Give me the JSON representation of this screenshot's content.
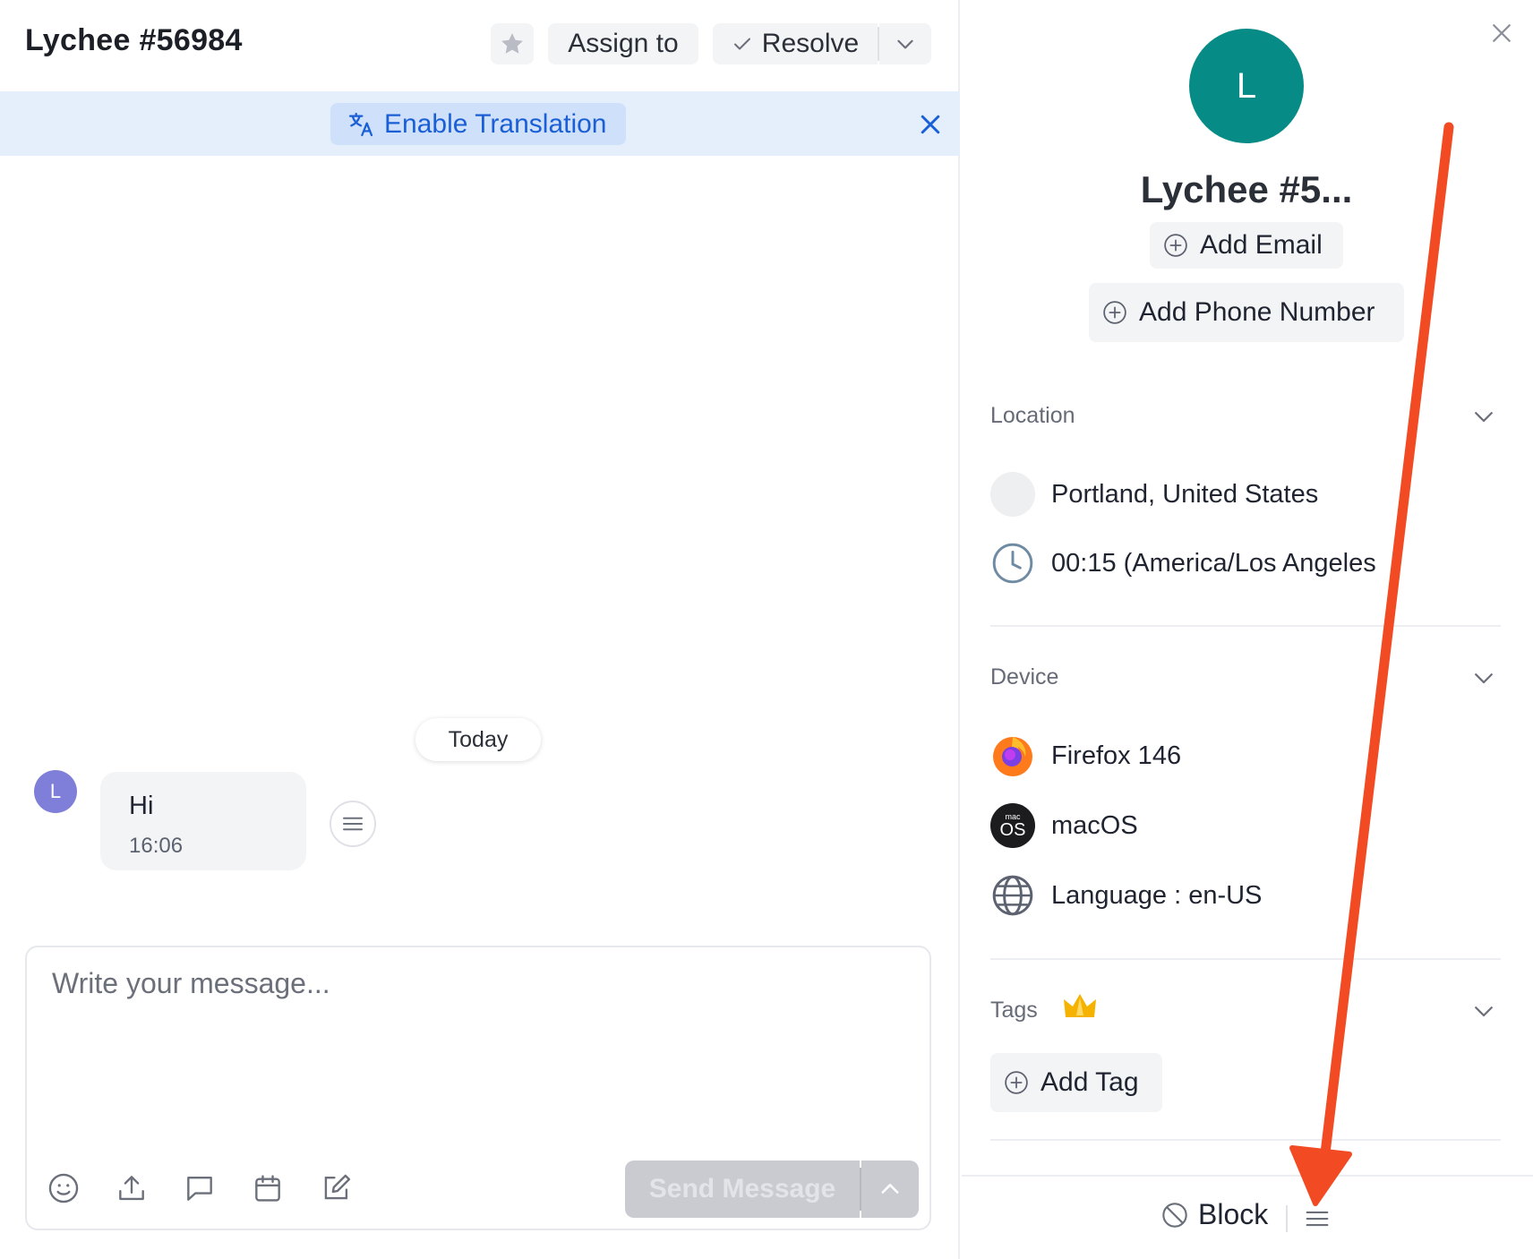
{
  "conversation": {
    "title": "Lychee #56984",
    "assign_label": "Assign to",
    "resolve_label": "Resolve"
  },
  "translation": {
    "button_label": "Enable Translation"
  },
  "messages": {
    "date_separator": "Today",
    "avatar_initial": "L",
    "items": [
      {
        "text": "Hi",
        "time": "16:06"
      }
    ]
  },
  "composer": {
    "placeholder": "Write your message...",
    "send_label": "Send Message",
    "tools": [
      "emoji-icon",
      "upload-icon",
      "chat-bubble-icon",
      "calendar-icon",
      "edit-icon"
    ]
  },
  "contact": {
    "avatar_initial": "L",
    "name": "Lychee #5...",
    "add_email_label": "Add Email",
    "add_phone_label": "Add Phone Number",
    "avatar_color": "#078b86"
  },
  "location": {
    "title": "Location",
    "place": "Portland, United States",
    "local_time": "00:15 (America/Los Angeles"
  },
  "device": {
    "title": "Device",
    "browser": "Firefox 146",
    "os": "macOS",
    "os_badge_top": "mac",
    "os_badge_bottom": "OS",
    "language": "Language : en-US"
  },
  "tags": {
    "title": "Tags",
    "add_tag_label": "Add Tag"
  },
  "footer": {
    "block_label": "Block"
  },
  "colors": {
    "accent_blue": "#1a5fd6",
    "translation_bar": "#e5effc",
    "annotation_arrow": "#f24a22"
  }
}
